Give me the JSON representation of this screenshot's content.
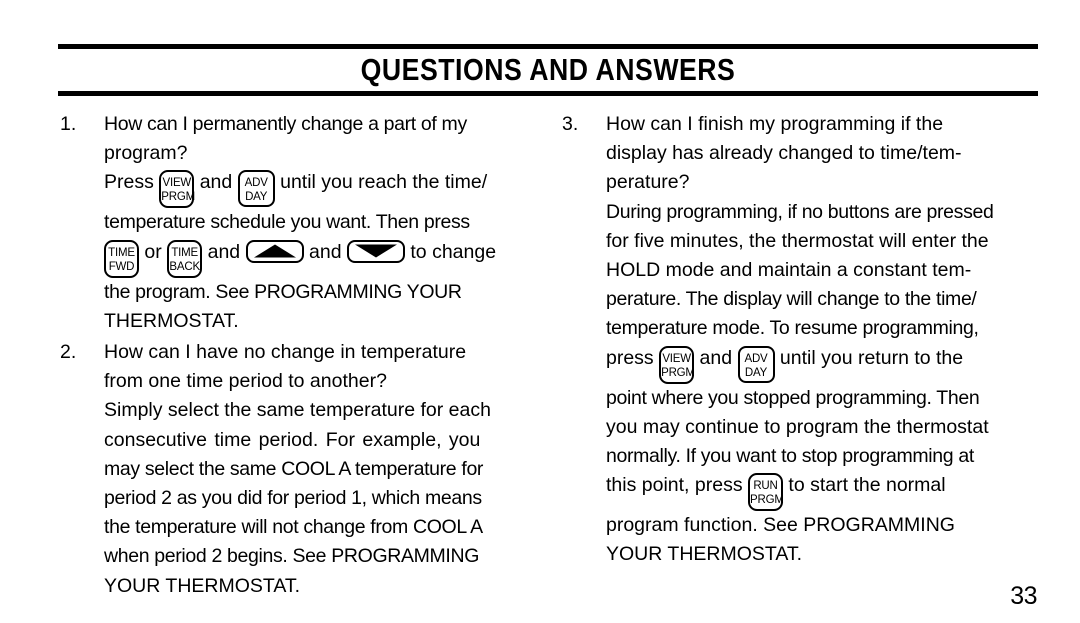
{
  "header": {
    "title": "QUESTIONS AND ANSWERS"
  },
  "keys": {
    "view_prgm": {
      "line1": "VIEW",
      "line2": "PRGM"
    },
    "adv_day": {
      "line1": "ADV",
      "line2": "DAY"
    },
    "time_fwd": {
      "line1": "TIME",
      "line2": "FWD"
    },
    "time_back": {
      "line1": "TIME",
      "line2": "BACK"
    },
    "run_prgm": {
      "line1": "RUN",
      "line2": "PRGM"
    },
    "up_arrow": "up-arrow",
    "down_arrow": "down-arrow"
  },
  "left_column": {
    "q1": {
      "number": "1.",
      "question_line1": "How can I permanently change a part of my",
      "question_line2": "program?",
      "answer_l1_a": "Press",
      "answer_l1_b": "and",
      "answer_l1_c": "until you reach the time/",
      "answer_l2": "temperature schedule you want.  Then press",
      "answer_l3_a": "or",
      "answer_l3_b": "and",
      "answer_l3_c": "and",
      "answer_l3_d": "to change",
      "answer_l4": "the program.  See PROGRAMMING YOUR",
      "answer_l5": "THERMOSTAT."
    },
    "q2": {
      "number": "2.",
      "question_line1": "How can I have no change in temperature",
      "question_line2": "from one time period to another?",
      "answer_l1": "Simply select the same temperature for each",
      "answer_l2": "consecutive time period.  For example,  you",
      "answer_l3": "may select the same COOL A temperature for",
      "answer_l4": "period 2 as you did for period 1, which means",
      "answer_l5": "the temperature will not change from COOL A",
      "answer_l6": "when period 2 begins.  See PROGRAMMING",
      "answer_l7": "YOUR THERMOSTAT."
    }
  },
  "right_column": {
    "q3": {
      "number": "3.",
      "question_line1": "How  can  I  finish  my  programming  if  the",
      "question_line2": "display  has  already  changed  to  time/tem-",
      "question_line3": "perature?",
      "answer_l1": "During programming, if no buttons are pressed",
      "answer_l2": "for five minutes, the thermostat will enter the",
      "answer_l3": "HOLD  mode  and  maintain  a  constant  tem-",
      "answer_l4": "perature.  The display will change to the time/",
      "answer_l5": "temperature mode. To resume programming,",
      "answer_l6_a": "press",
      "answer_l6_b": "and",
      "answer_l6_c": "until  you  return  to  the",
      "answer_l7": "point where you stopped programming.  Then",
      "answer_l8": "you may continue to program the thermostat",
      "answer_l9": "normally.  If you want to stop programming at",
      "answer_l10_a": "this  point,  press",
      "answer_l10_b": "to  start  the  normal",
      "answer_l11": "program  function.    See  PROGRAMMING",
      "answer_l12": "YOUR THERMOSTAT."
    }
  },
  "footer": {
    "page_number": "33"
  }
}
